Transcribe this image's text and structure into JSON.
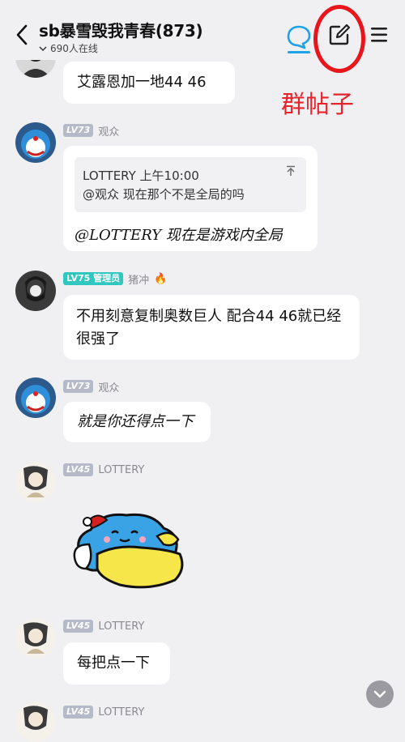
{
  "header": {
    "title": "sb暴雪毁我青春(873)",
    "online_count": "690人在线"
  },
  "annotation": {
    "text": "群帖子"
  },
  "messages": [
    {
      "text": "艾露恩加一地44 46"
    },
    {
      "level": "LV73",
      "name": "观众",
      "quote_author": "LOTTERY 上午10:00",
      "quote_text": "@观众 现在那个不是全局的吗",
      "reply": "@LOTTERY 现在是游戏内全局"
    },
    {
      "level": "LV75",
      "badge": "管理员",
      "name": "猪冲",
      "emoji": "🔥",
      "text": "不用刻意复制奥数巨人 配合44 46就已经很强了"
    },
    {
      "level": "LV73",
      "name": "观众",
      "text": "就是你还得点一下"
    },
    {
      "level": "LV45",
      "name": "LOTTERY",
      "sticker": "sleeping-blue-cat-sticker"
    },
    {
      "level": "LV45",
      "name": "LOTTERY",
      "text": "每把点一下"
    },
    {
      "level": "LV45",
      "name": "LOTTERY"
    }
  ],
  "colors": {
    "accent": "#1fa3e8",
    "annotation_red": "#e8151b",
    "admin_badge": "#2fc7c0"
  }
}
